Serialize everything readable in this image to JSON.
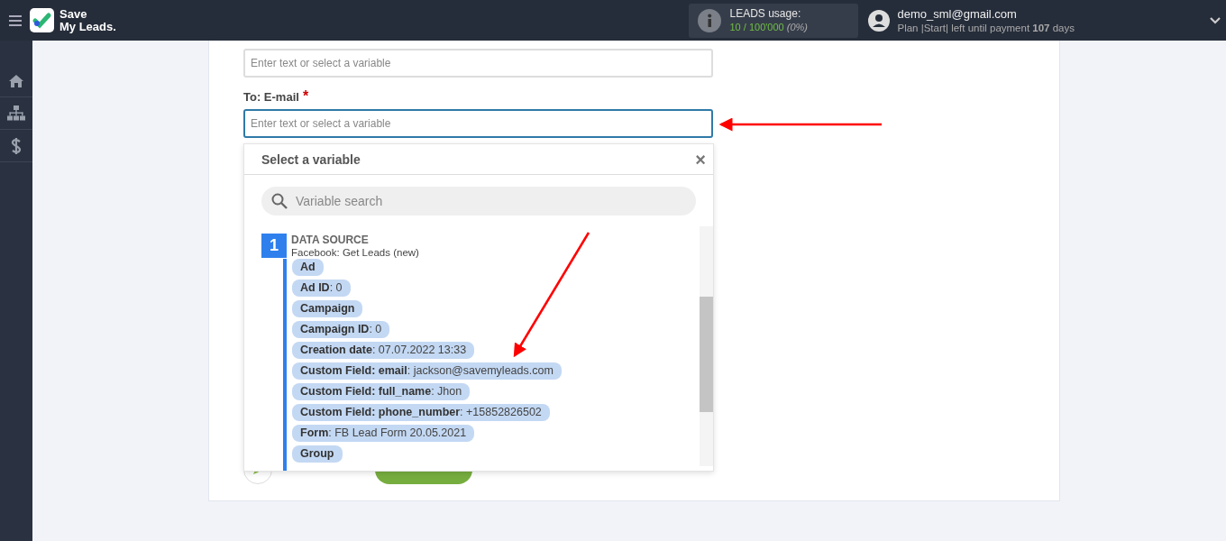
{
  "brand": {
    "line1": "Save",
    "line2": "My Leads."
  },
  "usage": {
    "label": "LEADS usage:",
    "count": "10 / 100'000",
    "percent": "(0%)"
  },
  "account": {
    "email": "demo_sml@gmail.com",
    "plan": "Plan |Start| left until payment **107** days"
  },
  "form": {
    "fields": [
      {
        "placeholder": "Enter text or select a variable",
        "focused": false
      },
      {
        "label": "To: E-mail",
        "placeholder": "Enter text or select a variable",
        "focused": true,
        "required_mark": "*"
      }
    ]
  },
  "popup": {
    "title": "Select a variable",
    "close": "×",
    "search_placeholder": "Variable search",
    "source": {
      "number": "1",
      "title": "DATA SOURCE",
      "subtitle": "Facebook: Get Leads (new)"
    },
    "items": [
      "**Ad**",
      "**Ad ID**: 0",
      "**Campaign**",
      "**Campaign ID**: 0",
      "**Creation date**: 07.07.2022 13:33",
      "**Custom Field: email**: jackson@savemyleads.com",
      "**Custom Field: full_name**: Jhon",
      "**Custom Field: phone_number**: +15852826502",
      "**Form**: FB Lead Form 20.05.2021",
      "**Group**"
    ]
  }
}
